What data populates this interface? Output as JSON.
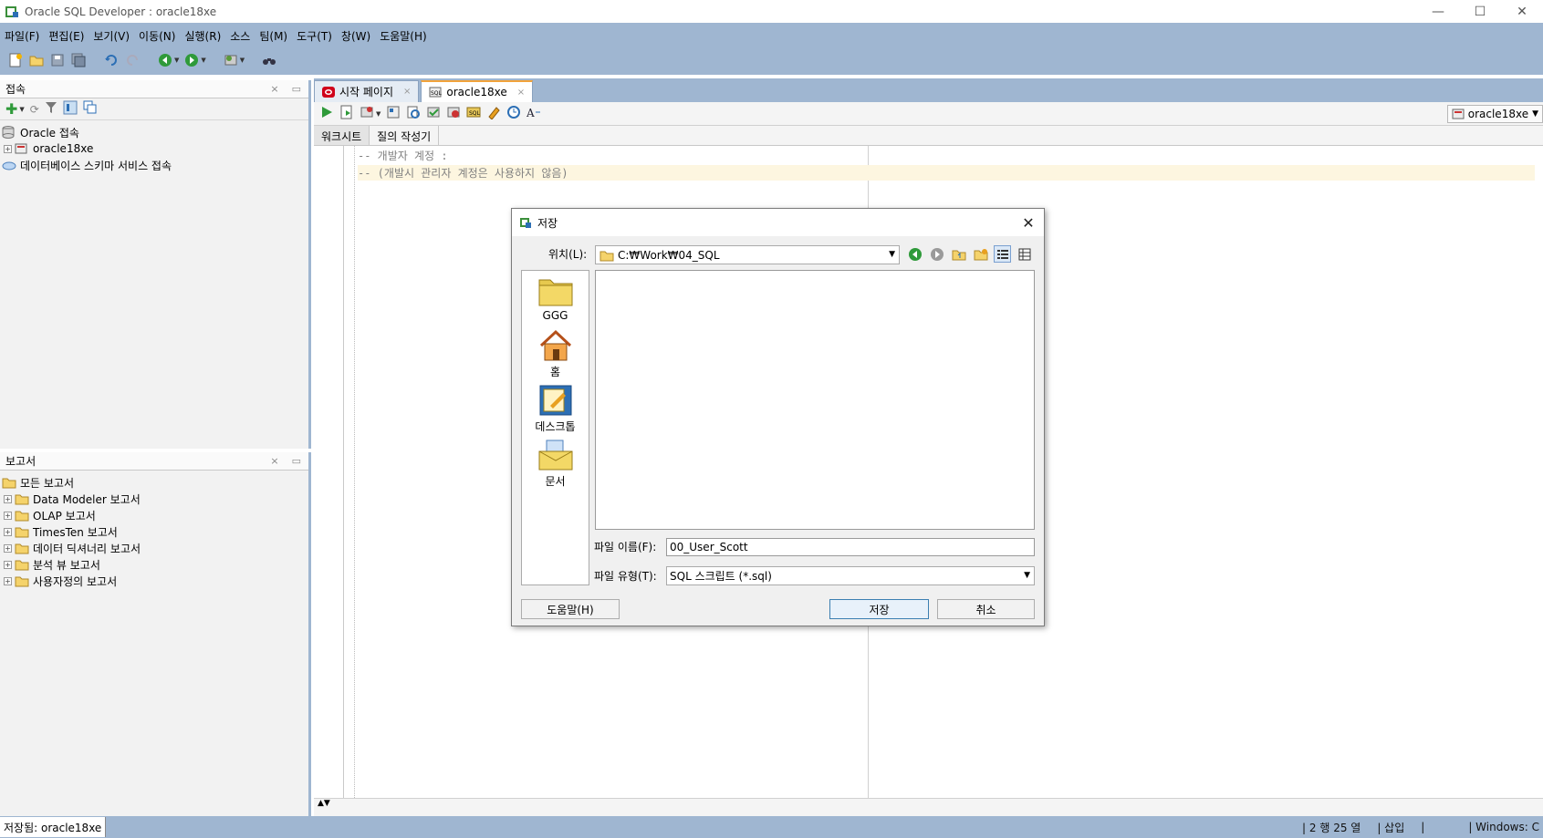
{
  "window": {
    "title": "Oracle SQL Developer : oracle18xe",
    "controls": {
      "minimize": "—",
      "maximize": "☐",
      "close": "✕"
    }
  },
  "menu": [
    "파일(F)",
    "편집(E)",
    "보기(V)",
    "이동(N)",
    "실행(R)",
    "소스",
    "팀(M)",
    "도구(T)",
    "창(W)",
    "도움말(H)"
  ],
  "connections_panel": {
    "title": "접속",
    "tree": [
      {
        "label": "Oracle 접속"
      },
      {
        "label": "oracle18xe"
      },
      {
        "label": "데이터베이스 스키마 서비스 접속"
      }
    ]
  },
  "reports_panel": {
    "title": "보고서",
    "tree": [
      {
        "label": "모든 보고서"
      },
      {
        "label": "Data Modeler 보고서"
      },
      {
        "label": "OLAP 보고서"
      },
      {
        "label": "TimesTen 보고서"
      },
      {
        "label": "데이터 딕셔너리 보고서"
      },
      {
        "label": "분석 뷰 보고서"
      },
      {
        "label": "사용자정의 보고서"
      }
    ]
  },
  "editor": {
    "tabs": [
      {
        "label": "시작 페이지"
      },
      {
        "label": "oracle18xe"
      }
    ],
    "connection_selector": "oracle18xe",
    "sub_tabs": [
      "워크시트",
      "질의 작성기"
    ],
    "code_lines": [
      "-- 개발자 계정 :",
      "-- (개발시 관리자 계정은 사용하지 않음)"
    ]
  },
  "status": {
    "left": "저장됨: oracle18xe",
    "position": "| 2 행 25 열",
    "mode": "| 삽입",
    "sep": "|",
    "os": "| Windows: C"
  },
  "save_dialog": {
    "title": "저장",
    "location_label": "위치(L):",
    "location_value": "C:₩Work₩04_SQL",
    "places": [
      {
        "label": "GGG",
        "icon": "folder-icon"
      },
      {
        "label": "홈",
        "icon": "home-icon"
      },
      {
        "label": "데스크톱",
        "icon": "desktop-icon"
      },
      {
        "label": "문서",
        "icon": "documents-icon"
      }
    ],
    "filename_label": "파일 이름(F):",
    "filename_value": "00_User_Scott",
    "filetype_label": "파일 유형(T):",
    "filetype_value": "SQL 스크립트 (*.sql)",
    "help_button": "도움말(H)",
    "save_button": "저장",
    "cancel_button": "취소"
  },
  "colors": {
    "chrome": "#9fb6d1",
    "accent_tab": "#f2a33a",
    "comment_text": "#808080"
  }
}
